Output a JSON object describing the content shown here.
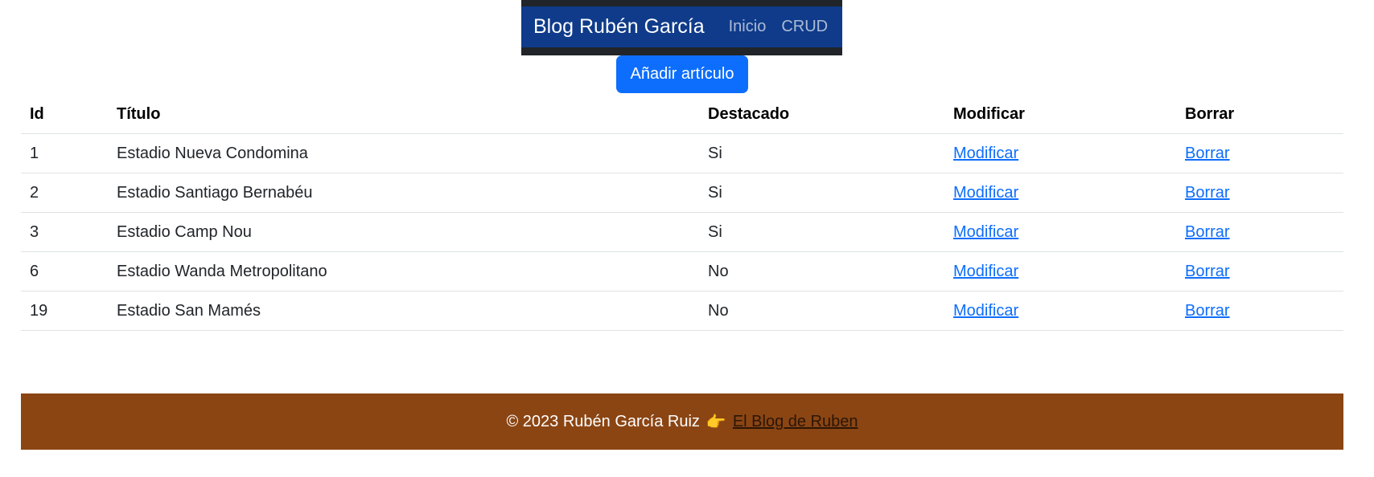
{
  "navbar": {
    "brand": "Blog Rubén García",
    "links": [
      "Inicio",
      "CRUD"
    ]
  },
  "add_button_label": "Añadir artículo",
  "table": {
    "headers": [
      "Id",
      "Título",
      "Destacado",
      "Modificar",
      "Borrar"
    ],
    "rows": [
      {
        "id": "1",
        "title": "Estadio Nueva Condomina",
        "featured": "Si",
        "edit": "Modificar",
        "delete": "Borrar"
      },
      {
        "id": "2",
        "title": "Estadio Santiago Bernabéu",
        "featured": "Si",
        "edit": "Modificar",
        "delete": "Borrar"
      },
      {
        "id": "3",
        "title": "Estadio Camp Nou",
        "featured": "Si",
        "edit": "Modificar",
        "delete": "Borrar"
      },
      {
        "id": "6",
        "title": "Estadio Wanda Metropolitano",
        "featured": "No",
        "edit": "Modificar",
        "delete": "Borrar"
      },
      {
        "id": "19",
        "title": "Estadio San Mamés",
        "featured": "No",
        "edit": "Modificar",
        "delete": "Borrar"
      }
    ]
  },
  "footer": {
    "copyright": "© 2023 Rubén García Ruiz",
    "emoji": "👉",
    "link_text": "El Blog de Ruben"
  },
  "colors": {
    "navbar_bg": "#0f3b8a",
    "primary": "#0d6efd",
    "footer_bg": "#8b4513"
  }
}
